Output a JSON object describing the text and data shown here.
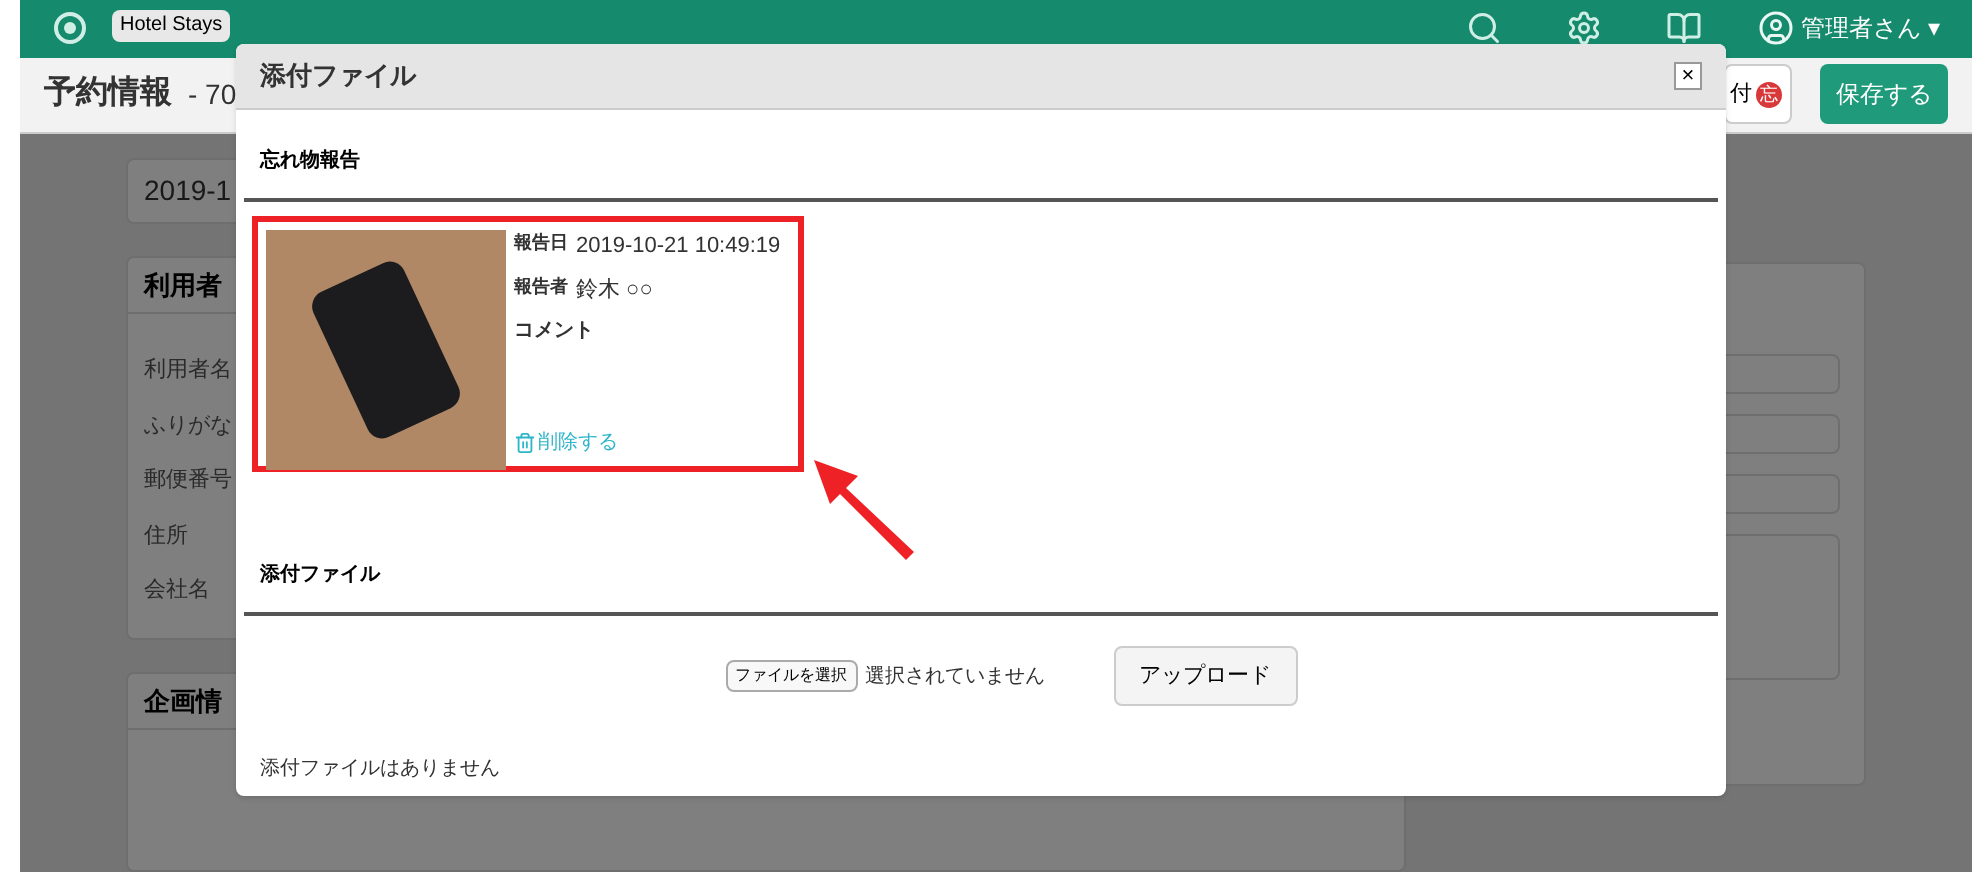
{
  "header": {
    "hotel_select": "Hotel Stays",
    "user": "管理者さん ▾"
  },
  "page": {
    "title": "予約情報",
    "number": "- 70",
    "badge_button": {
      "label": "付",
      "badge": "忘"
    },
    "save_button": "保存する"
  },
  "background": {
    "date_field": "2019-1",
    "guest_card": {
      "title": "利用者",
      "fields": [
        "利用者名",
        "ふりがな",
        "郵便番号",
        "住所",
        "会社名"
      ]
    },
    "plan_card": {
      "title": "企画情"
    }
  },
  "modal": {
    "title": "添付ファイル",
    "close": "×",
    "lost_item": {
      "heading": "忘れ物報告",
      "report": {
        "date_label": "報告日",
        "date": "2019-10-21 10:49:19",
        "reporter_label": "報告者",
        "reporter": "鈴木 ○○",
        "comment_label": "コメント",
        "delete": "削除する",
        "highlighted": true
      }
    },
    "attachments": {
      "heading": "添付ファイル",
      "choose_button": "ファイルを選択",
      "no_file": "選択されていません",
      "upload_button": "アップロード",
      "empty": "添付ファイルはありません"
    }
  }
}
